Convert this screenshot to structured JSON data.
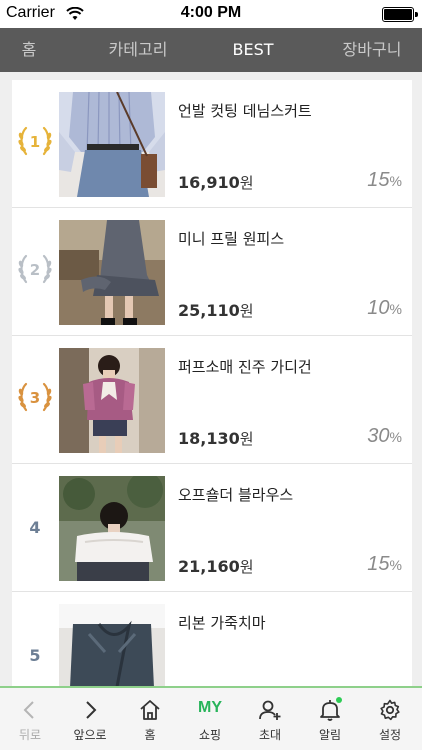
{
  "status_bar": {
    "carrier": "Carrier",
    "time": "4:00 PM"
  },
  "top_nav": {
    "tabs": [
      {
        "label": "홈"
      },
      {
        "label": "카테고리"
      },
      {
        "label": "BEST"
      },
      {
        "label": "장바구니"
      }
    ]
  },
  "products": [
    {
      "rank": "1",
      "name": "언발 컷팅 데님스커트",
      "price": "16,910",
      "currency": "원",
      "discount": "15",
      "discount_unit": "%",
      "medal": "gold"
    },
    {
      "rank": "2",
      "name": "미니 프릴 원피스",
      "price": "25,110",
      "currency": "원",
      "discount": "10",
      "discount_unit": "%",
      "medal": "silver"
    },
    {
      "rank": "3",
      "name": "퍼프소매 진주 가디건",
      "price": "18,130",
      "currency": "원",
      "discount": "30",
      "discount_unit": "%",
      "medal": "bronze"
    },
    {
      "rank": "4",
      "name": "오프숄더 블라우스",
      "price": "21,160",
      "currency": "원",
      "discount": "15",
      "discount_unit": "%",
      "medal": ""
    },
    {
      "rank": "5",
      "name": "리본 가죽치마",
      "price": "",
      "currency": "",
      "discount": "",
      "discount_unit": "",
      "medal": ""
    }
  ],
  "bottom_bar": {
    "back": "뒤로",
    "forward": "앞으로",
    "home": "홈",
    "my_text": "MY",
    "shopping": "쇼핑",
    "invite": "초대",
    "notifications": "알림",
    "settings": "설정"
  },
  "colors": {
    "accent": "#27b45a",
    "gold": "#e6b33a",
    "silver": "#b9bfc6",
    "bronze": "#d9923f",
    "rank_plain": "#6d7f95",
    "nav_bg": "#5a5a5a"
  }
}
